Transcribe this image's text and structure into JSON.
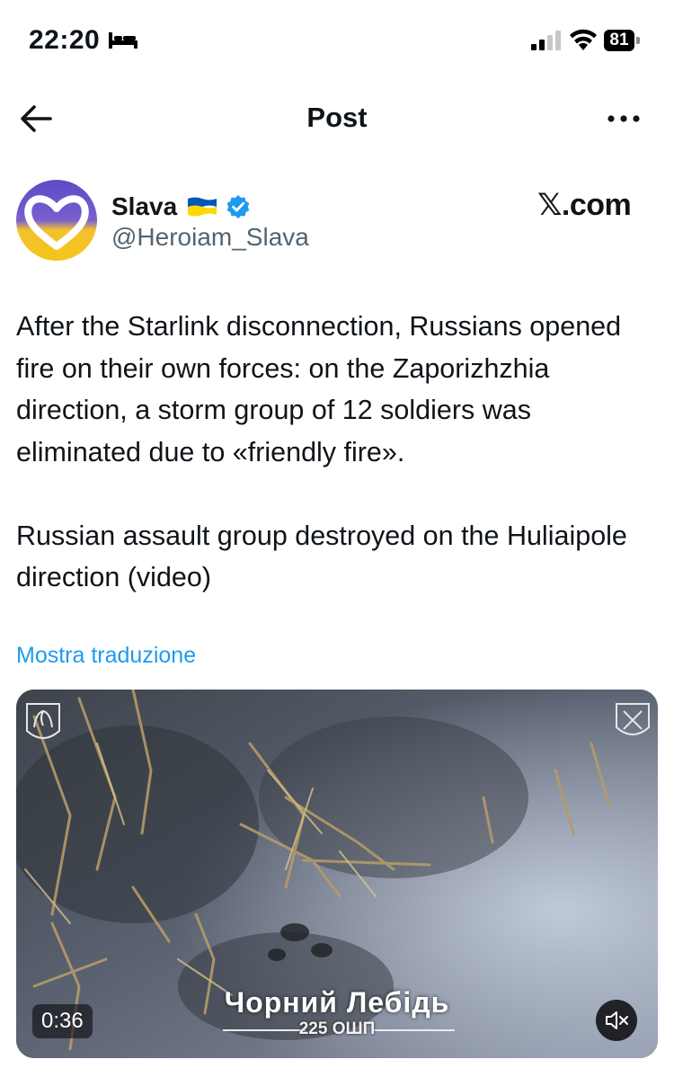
{
  "status_bar": {
    "time": "22:20",
    "battery": "81"
  },
  "nav": {
    "title": "Post"
  },
  "author": {
    "name": "Slava",
    "handle": "@Heroiam_Slava",
    "source_logo": "𝕏.com"
  },
  "post": {
    "paragraphs": [
      "After the Starlink disconnection, Russians opened fire on their own forces: on the Zaporizhzhia direction, a storm group of 12 soldiers was eliminated due to «friendly fire».",
      "Russian assault group destroyed on the Huliaipole direction (video)"
    ]
  },
  "translate_link": "Mostra traduzione",
  "video": {
    "duration": "0:36",
    "overlay_title": "Чорний Лебідь",
    "overlay_subtitle": "225 ОШП"
  },
  "icons": {
    "back": "arrow-left-icon",
    "more": "more-horizontal-icon",
    "verified": "verified-badge-icon",
    "flag": "ukraine-flag-icon",
    "mute": "speaker-muted-icon"
  },
  "colors": {
    "accent": "#1d9bf0",
    "text": "#0f1419",
    "secondary_text": "#536471",
    "flag_blue": "#0057b7",
    "flag_yellow": "#ffd700"
  }
}
